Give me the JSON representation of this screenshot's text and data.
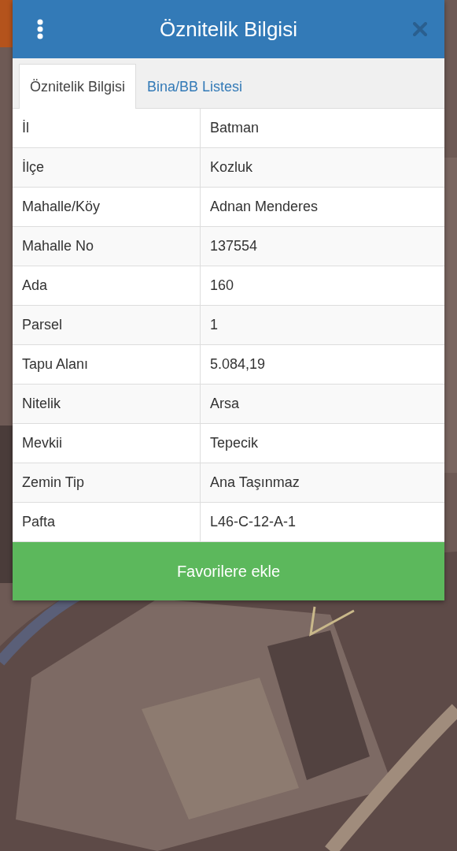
{
  "dialog": {
    "title": "Öznitelik Bilgisi"
  },
  "tabs": [
    {
      "label": "Öznitelik Bilgisi",
      "selected": true
    },
    {
      "label": "Bina/BB Listesi",
      "selected": false
    }
  ],
  "rows": [
    {
      "label": "İl",
      "value": "Batman"
    },
    {
      "label": "İlçe",
      "value": "Kozluk"
    },
    {
      "label": "Mahalle/Köy",
      "value": "Adnan Menderes"
    },
    {
      "label": "Mahalle No",
      "value": "137554"
    },
    {
      "label": "Ada",
      "value": "160"
    },
    {
      "label": "Parsel",
      "value": "1"
    },
    {
      "label": "Tapu Alanı",
      "value": "5.084,19"
    },
    {
      "label": "Nitelik",
      "value": "Arsa"
    },
    {
      "label": "Mevkii",
      "value": "Tepecik"
    },
    {
      "label": "Zemin Tip",
      "value": "Ana Taşınmaz"
    },
    {
      "label": "Pafta",
      "value": "L46-C-12-A-1"
    }
  ],
  "button": {
    "label": "Favorilere ekle"
  }
}
